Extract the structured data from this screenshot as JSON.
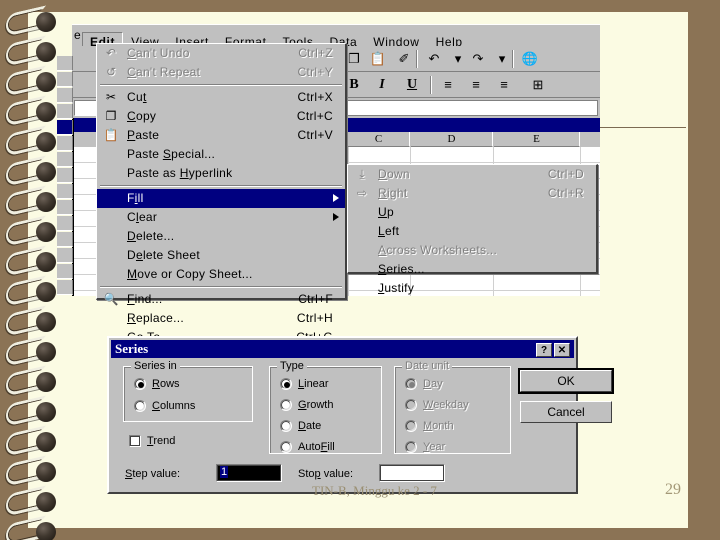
{
  "slide": {
    "footer_text": "TIN-B, Minggu ke 2 - 7",
    "page_number": "29",
    "background_color": "#8b7355",
    "page_color": "#fbfbe3"
  },
  "excel": {
    "menubar": [
      {
        "label": "e",
        "clipped": true,
        "selected": false
      },
      {
        "label": "Edit",
        "clipped": false,
        "selected": true
      },
      {
        "label": "View",
        "clipped": false,
        "selected": false
      },
      {
        "label": "Insert",
        "clipped": false,
        "selected": false
      },
      {
        "label": "Format",
        "clipped": false,
        "selected": false
      },
      {
        "label": "Tools",
        "clipped": false,
        "selected": false
      },
      {
        "label": "Data",
        "clipped": false,
        "selected": false
      },
      {
        "label": "Window",
        "clipped": false,
        "selected": false
      },
      {
        "label": "Help",
        "clipped": false,
        "selected": false
      }
    ],
    "toolbar_standard": [
      {
        "name": "copy-icon",
        "glyph": "❐"
      },
      {
        "name": "paste-icon",
        "glyph": "📋"
      },
      {
        "name": "format-painter-icon",
        "glyph": "✐"
      },
      {
        "name": "undo-icon",
        "glyph": "↶"
      },
      {
        "name": "undo-dropdown-icon",
        "glyph": "▾"
      },
      {
        "name": "redo-icon",
        "glyph": "↷"
      },
      {
        "name": "redo-dropdown-icon",
        "glyph": "▾"
      },
      {
        "name": "hyperlink-icon",
        "glyph": "🌐"
      }
    ],
    "toolbar_formatting": [
      {
        "name": "bold-button",
        "glyph": "B"
      },
      {
        "name": "italic-button",
        "glyph": "I"
      },
      {
        "name": "underline-button",
        "glyph": "U"
      },
      {
        "name": "align-left-button",
        "glyph": "≡"
      },
      {
        "name": "align-center-button",
        "glyph": "≡"
      },
      {
        "name": "align-right-button",
        "glyph": "≡"
      },
      {
        "name": "merge-center-button",
        "glyph": "⊞"
      }
    ],
    "formula_bar": {
      "name_box_value": "",
      "equals_sign": "=",
      "formula_value": ""
    },
    "sheet": {
      "column_headers": [
        "C",
        "D",
        "E"
      ],
      "row_headers": [
        "",
        "",
        "",
        "",
        "",
        "",
        "",
        "",
        ""
      ]
    }
  },
  "edit_menu": {
    "items": [
      {
        "label": "Can't Undo",
        "accel": "Ctrl+Z",
        "icon": "undo-icon",
        "glyph": "↶",
        "disabled": true,
        "highlighted": false,
        "submenu": false,
        "underline_index": 0
      },
      {
        "label": "Can't Repeat",
        "accel": "Ctrl+Y",
        "icon": "repeat-icon",
        "glyph": "↺",
        "disabled": true,
        "highlighted": false,
        "submenu": false,
        "underline_index": 0
      },
      {
        "separator": true
      },
      {
        "label": "Cut",
        "accel": "Ctrl+X",
        "icon": "scissors-icon",
        "glyph": "✂",
        "disabled": false,
        "highlighted": false,
        "submenu": false,
        "underline_index": 2
      },
      {
        "label": "Copy",
        "accel": "Ctrl+C",
        "icon": "copy-icon",
        "glyph": "❐",
        "disabled": false,
        "highlighted": false,
        "submenu": false,
        "underline_index": 0
      },
      {
        "label": "Paste",
        "accel": "Ctrl+V",
        "icon": "paste-icon",
        "glyph": "📋",
        "disabled": false,
        "highlighted": false,
        "submenu": false,
        "underline_index": 0
      },
      {
        "label": "Paste Special...",
        "accel": "",
        "icon": "",
        "glyph": "",
        "disabled": false,
        "highlighted": false,
        "submenu": false,
        "underline_index": 6
      },
      {
        "label": "Paste as Hyperlink",
        "accel": "",
        "icon": "",
        "glyph": "",
        "disabled": false,
        "highlighted": false,
        "submenu": false,
        "underline_index": 9
      },
      {
        "separator": true
      },
      {
        "label": "Fill",
        "accel": "",
        "icon": "",
        "glyph": "",
        "disabled": false,
        "highlighted": true,
        "submenu": true,
        "underline_index": 1
      },
      {
        "label": "Clear",
        "accel": "",
        "icon": "",
        "glyph": "",
        "disabled": false,
        "highlighted": false,
        "submenu": true,
        "underline_index": 1
      },
      {
        "label": "Delete...",
        "accel": "",
        "icon": "",
        "glyph": "",
        "disabled": false,
        "highlighted": false,
        "submenu": false,
        "underline_index": 0
      },
      {
        "label": "Delete Sheet",
        "accel": "",
        "icon": "",
        "glyph": "",
        "disabled": false,
        "highlighted": false,
        "submenu": false,
        "underline_index": 1
      },
      {
        "label": "Move or Copy Sheet...",
        "accel": "",
        "icon": "",
        "glyph": "",
        "disabled": false,
        "highlighted": false,
        "submenu": false,
        "underline_index": 0
      },
      {
        "separator": true
      },
      {
        "label": "Find...",
        "accel": "Ctrl+F",
        "icon": "binoculars-icon",
        "glyph": "🔍",
        "disabled": false,
        "highlighted": false,
        "submenu": false,
        "underline_index": 0
      },
      {
        "label": "Replace...",
        "accel": "Ctrl+H",
        "icon": "",
        "glyph": "",
        "disabled": false,
        "highlighted": false,
        "submenu": false,
        "underline_index": 0
      },
      {
        "label": "Go To...",
        "accel": "Ctrl+G",
        "icon": "",
        "glyph": "",
        "disabled": false,
        "highlighted": false,
        "submenu": false,
        "underline_index": 0
      }
    ]
  },
  "fill_submenu": {
    "items": [
      {
        "label": "Down",
        "accel": "Ctrl+D",
        "icon": "fill-down-icon",
        "glyph": "⤓",
        "disabled": true
      },
      {
        "label": "Right",
        "accel": "Ctrl+R",
        "icon": "fill-right-icon",
        "glyph": "⇨",
        "disabled": true
      },
      {
        "label": "Up",
        "accel": "",
        "icon": "",
        "glyph": "",
        "disabled": false
      },
      {
        "label": "Left",
        "accel": "",
        "icon": "",
        "glyph": "",
        "disabled": false
      },
      {
        "label": "Across Worksheets...",
        "accel": "",
        "icon": "",
        "glyph": "",
        "disabled": true
      },
      {
        "label": "Series...",
        "accel": "",
        "icon": "",
        "glyph": "",
        "disabled": false
      },
      {
        "label": "Justify",
        "accel": "",
        "icon": "",
        "glyph": "",
        "disabled": false
      }
    ]
  },
  "series_dialog": {
    "title": "Series",
    "help_button": "?",
    "close_button": "✕",
    "series_in": {
      "legend": "Series in",
      "options": [
        {
          "label": "Rows",
          "selected": true
        },
        {
          "label": "Columns",
          "selected": false
        }
      ]
    },
    "type": {
      "legend": "Type",
      "options": [
        {
          "label": "Linear",
          "selected": true
        },
        {
          "label": "Growth",
          "selected": false
        },
        {
          "label": "Date",
          "selected": false
        },
        {
          "label": "AutoFill",
          "selected": false
        }
      ]
    },
    "date_unit": {
      "legend": "Date unit",
      "disabled": true,
      "options": [
        {
          "label": "Day",
          "selected": true
        },
        {
          "label": "Weekday",
          "selected": false
        },
        {
          "label": "Month",
          "selected": false
        },
        {
          "label": "Year",
          "selected": false
        }
      ]
    },
    "trend_checkbox": {
      "label": "Trend",
      "checked": false
    },
    "step_value": {
      "label": "Step value:",
      "value": "1",
      "selected": true
    },
    "stop_value": {
      "label": "Stop value:",
      "value": ""
    },
    "ok_button": "OK",
    "cancel_button": "Cancel"
  }
}
